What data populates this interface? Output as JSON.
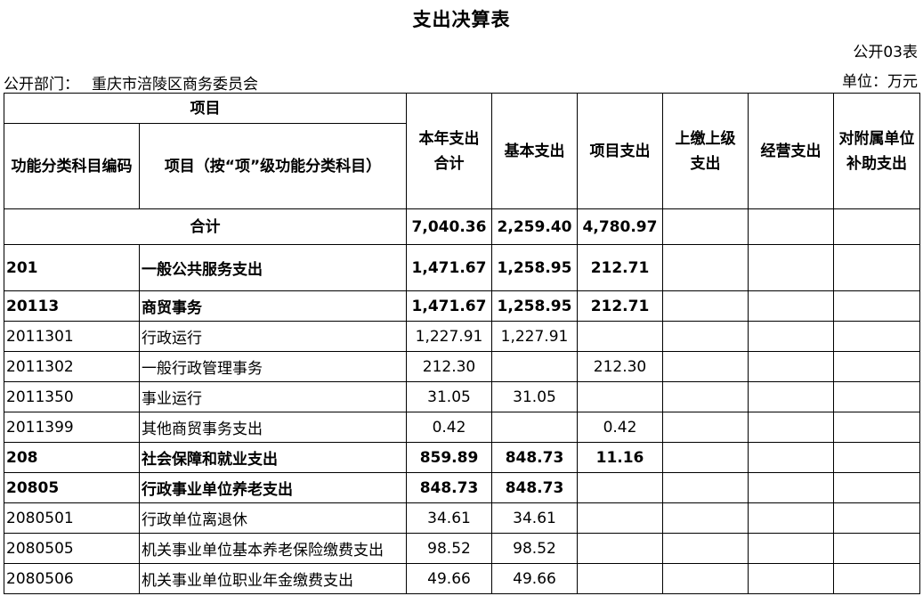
{
  "title": "支出决算表",
  "table_no": "公开03表",
  "department": {
    "label": "公开部门：",
    "value": "重庆市涪陵区商务委员会"
  },
  "unit": "单位：万元",
  "headers": {
    "item_group": "项目",
    "func_code": "功能分类科目编码",
    "item_name": "项目（按“项”级功能分类科目）",
    "total_line1": "本年支出",
    "total_line2": "合计",
    "basic": "基本支出",
    "project": "项目支出",
    "upper_line1": "上缴上级",
    "upper_line2": "支出",
    "operating": "经营支出",
    "subsidy_line1": "对附属单位",
    "subsidy_line2": "补助支出"
  },
  "total_row": {
    "label": "合计",
    "total": "7,040.36",
    "basic": "2,259.40",
    "project": "4,780.97"
  },
  "rows": [
    {
      "code": "201",
      "name": "一般公共服务支出",
      "total": "1,471.67",
      "basic": "1,258.95",
      "project": "212.71",
      "bold": true
    },
    {
      "code": "20113",
      "name": "商贸事务",
      "total": "1,471.67",
      "basic": "1,258.95",
      "project": "212.71",
      "bold": true
    },
    {
      "code": "2011301",
      "name": "行政运行",
      "total": "1,227.91",
      "basic": "1,227.91",
      "project": "",
      "bold": false
    },
    {
      "code": "2011302",
      "name": "一般行政管理事务",
      "total": "212.30",
      "basic": "",
      "project": "212.30",
      "bold": false
    },
    {
      "code": "2011350",
      "name": "事业运行",
      "total": "31.05",
      "basic": "31.05",
      "project": "",
      "bold": false
    },
    {
      "code": "2011399",
      "name": "其他商贸事务支出",
      "total": "0.42",
      "basic": "",
      "project": "0.42",
      "bold": false
    },
    {
      "code": "208",
      "name": "社会保障和就业支出",
      "total": "859.89",
      "basic": "848.73",
      "project": "11.16",
      "bold": true
    },
    {
      "code": "20805",
      "name": "行政事业单位养老支出",
      "total": "848.73",
      "basic": "848.73",
      "project": "",
      "bold": true
    },
    {
      "code": "2080501",
      "name": "行政单位离退休",
      "total": "34.61",
      "basic": "34.61",
      "project": "",
      "bold": false
    },
    {
      "code": "2080505",
      "name": "机关事业单位基本养老保险缴费支出",
      "total": "98.52",
      "basic": "98.52",
      "project": "",
      "bold": false
    },
    {
      "code": "2080506",
      "name": "机关事业单位职业年金缴费支出",
      "total": "49.66",
      "basic": "49.66",
      "project": "",
      "bold": false
    }
  ]
}
